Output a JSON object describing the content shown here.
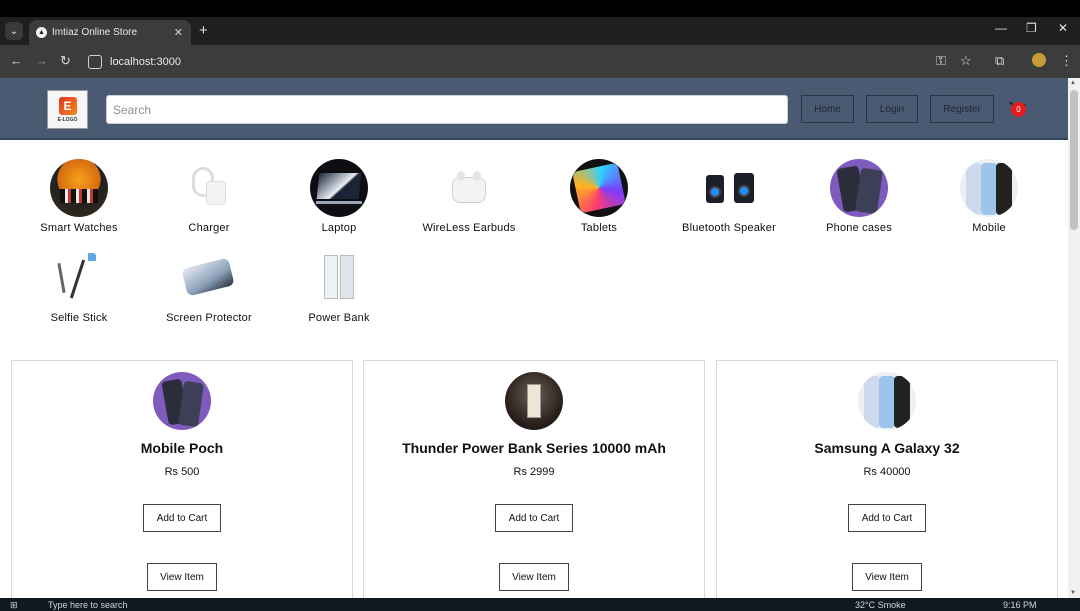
{
  "browser": {
    "tab_title": "Imtiaz Online Store",
    "new_tab": "+",
    "url": "localhost:3000"
  },
  "header": {
    "logo_text": "E-LOGO",
    "search_placeholder": "Search",
    "nav": [
      "Home",
      "Login",
      "Register"
    ],
    "cart_count": "0"
  },
  "categories": [
    {
      "label": "Smart Watches",
      "icon": "smartwatch-image"
    },
    {
      "label": "Charger",
      "icon": "charger-image"
    },
    {
      "label": "Laptop",
      "icon": "laptop-image"
    },
    {
      "label": "WireLess Earbuds",
      "icon": "earbuds-image"
    },
    {
      "label": "Tablets",
      "icon": "tablet-image"
    },
    {
      "label": "Bluetooth Speaker",
      "icon": "speaker-image"
    },
    {
      "label": "Phone cases",
      "icon": "phone-case-image"
    },
    {
      "label": "Mobile",
      "icon": "mobile-image"
    },
    {
      "label": "Selfie Stick",
      "icon": "selfie-stick-image"
    },
    {
      "label": "Screen Protector",
      "icon": "screen-protector-image"
    },
    {
      "label": "Power Bank",
      "icon": "power-bank-image"
    }
  ],
  "products": [
    {
      "name": "Mobile Poch",
      "price": "Rs 500",
      "add_label": "Add to Cart",
      "view_label": "View Item"
    },
    {
      "name": "Thunder Power Bank Series 10000 mAh",
      "price": "Rs 2999",
      "add_label": "Add to Cart",
      "view_label": "View Item"
    },
    {
      "name": "Samsung A Galaxy 32",
      "price": "Rs 40000",
      "add_label": "Add to Cart",
      "view_label": "View Item"
    }
  ],
  "taskbar": {
    "search_text": "Type here to search",
    "weather": "32°C  Smoke",
    "time": "9:16 PM"
  },
  "colors": {
    "header_bg": "#4a5a72",
    "badge": "#e21b1b"
  }
}
